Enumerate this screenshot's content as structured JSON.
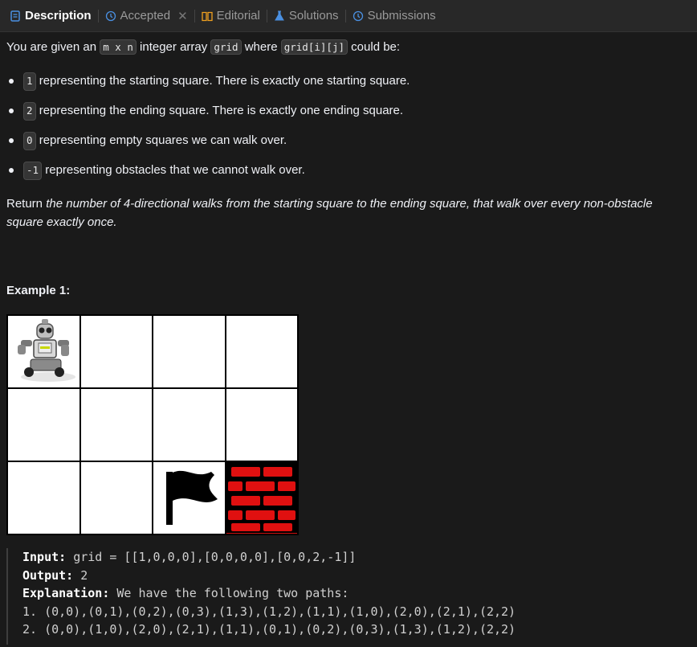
{
  "tabs": {
    "description": "Description",
    "accepted": "Accepted",
    "editorial": "Editorial",
    "solutions": "Solutions",
    "submissions": "Submissions"
  },
  "intro": {
    "pre": "You are given an",
    "mn": "m x n",
    "mid": "integer array",
    "grid": "grid",
    "where": "where",
    "gridij": "grid[i][j]",
    "post": "could be:"
  },
  "items": [
    {
      "code": "1",
      "text": "representing the starting square. There is exactly one starting square."
    },
    {
      "code": "2",
      "text": "representing the ending square. There is exactly one ending square."
    },
    {
      "code": "0",
      "text": "representing empty squares we can walk over."
    },
    {
      "code": "-1",
      "text": "representing obstacles that we cannot walk over."
    }
  ],
  "return": {
    "pre": "Return",
    "em": "the number of 4-directional walks from the starting square to the ending square, that walk over every non-obstacle square exactly once."
  },
  "example": {
    "heading": "Example 1:",
    "input_label": "Input:",
    "input_value": "grid = [[1,0,0,0],[0,0,0,0],[0,0,2,-1]]",
    "output_label": "Output:",
    "output_value": "2",
    "explanation_label": "Explanation:",
    "explanation_value": "We have the following two paths:",
    "path1": "1. (0,0),(0,1),(0,2),(0,3),(1,3),(1,2),(1,1),(1,0),(2,0),(2,1),(2,2)",
    "path2": "2. (0,0),(1,0),(2,0),(2,1),(1,1),(0,1),(0,2),(0,3),(1,3),(1,2),(2,2)"
  },
  "grid_cells": [
    "robot",
    "empty",
    "empty",
    "empty",
    "empty",
    "empty",
    "empty",
    "empty",
    "empty",
    "empty",
    "flag",
    "wall"
  ],
  "colors": {
    "accent_blue": "#4a90e2",
    "wall": "#cc1010",
    "bg": "#1a1a1a"
  }
}
